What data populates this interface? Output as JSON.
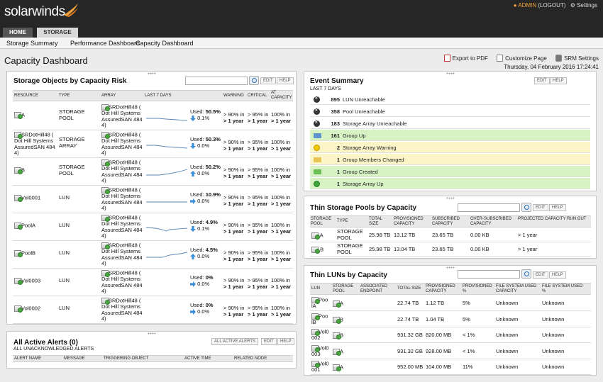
{
  "brand": "solarwinds",
  "user": {
    "name": "ADMIN",
    "logout": "(LOGOUT)",
    "settings": "Settings"
  },
  "tabs": {
    "home": "HOME",
    "storage": "STORAGE"
  },
  "subnav": [
    "Storage Summary",
    "Performance Dashboard",
    "Capacity Dashboard"
  ],
  "page": {
    "title": "Capacity Dashboard",
    "export_pdf": "Export to PDF",
    "customize": "Customize Page",
    "srm_settings": "SRM Settings",
    "datetime": "Thursday, 04 February 2016 17:24:41"
  },
  "buttons": {
    "edit": "EDIT",
    "help": "HELP",
    "all_active_alerts": "ALL ACTIVE ALERTS"
  },
  "risk": {
    "title": "Storage Objects by Capacity Risk",
    "headers": [
      "RESOURCE",
      "TYPE",
      "ARRAY",
      "LAST 7 DAYS",
      "WARNING",
      "CRITICAL",
      "AT CAPACITY"
    ],
    "rows": [
      {
        "resource": "A",
        "type": "STORAGE POOL",
        "array": "SRDotHill48 ( Dot Hill Systems AssuredSAN 484 4)",
        "used_label": "Used:",
        "used": "50.5%",
        "change": "0.1%",
        "dir": "down",
        "warn1": "> 90% in",
        "warn2": "> 1 year",
        "crit1": "> 95% in",
        "crit2": "> 1 year",
        "cap1": "100% in",
        "cap2": "> 1 year"
      },
      {
        "resource": "SRDotHill48 ( Dot Hill Systems AssuredSAN 484 4)",
        "type": "STORAGE ARRAY",
        "array": "SRDotHill48 ( Dot Hill Systems AssuredSAN 484 4)",
        "used_label": "Used:",
        "used": "50.3%",
        "change": "0.0%",
        "dir": "down",
        "warn1": "> 90% in",
        "warn2": "> 1 year",
        "crit1": "> 95% in",
        "crit2": "> 1 year",
        "cap1": "100% in",
        "cap2": "> 1 year"
      },
      {
        "resource": "B",
        "type": "STORAGE POOL",
        "array": "SRDotHill48 ( Dot Hill Systems AssuredSAN 484 4)",
        "used_label": "Used:",
        "used": "50.2%",
        "change": "0.0%",
        "dir": "up",
        "warn1": "> 90% in",
        "warn2": "> 1 year",
        "crit1": "> 95% in",
        "crit2": "> 1 year",
        "cap1": "100% in",
        "cap2": "> 1 year"
      },
      {
        "resource": "Vol0001",
        "type": "LUN",
        "array": "SRDotHill48 ( Dot Hill Systems AssuredSAN 484 4)",
        "used_label": "Used:",
        "used": "10.9%",
        "change": "0.0%",
        "dir": "right",
        "warn1": "> 90% in",
        "warn2": "> 1 year",
        "crit1": "> 95% in",
        "crit2": "> 1 year",
        "cap1": "100% in",
        "cap2": "> 1 year"
      },
      {
        "resource": "PoolA",
        "type": "LUN",
        "array": "SRDotHill48 ( Dot Hill Systems AssuredSAN 484 4)",
        "used_label": "Used:",
        "used": "4.9%",
        "change": "0.1%",
        "dir": "down",
        "warn1": "> 90% in",
        "warn2": "> 1 year",
        "crit1": "> 95% in",
        "crit2": "> 1 year",
        "cap1": "100% in",
        "cap2": "> 1 year"
      },
      {
        "resource": "PoolB",
        "type": "LUN",
        "array": "SRDotHill48 ( Dot Hill Systems AssuredSAN 484 4)",
        "used_label": "Used:",
        "used": "4.5%",
        "change": "0.0%",
        "dir": "up",
        "warn1": "> 90% in",
        "warn2": "> 1 year",
        "crit1": "> 95% in",
        "crit2": "> 1 year",
        "cap1": "100% in",
        "cap2": "> 1 year"
      },
      {
        "resource": "Vol0003",
        "type": "LUN",
        "array": "SRDotHill48 ( Dot Hill Systems AssuredSAN 484 4)",
        "used_label": "Used:",
        "used": "0%",
        "change": "0.0%",
        "dir": "right",
        "warn1": "> 90% in",
        "warn2": "> 1 year",
        "crit1": "> 95% in",
        "crit2": "> 1 year",
        "cap1": "100% in",
        "cap2": "> 1 year"
      },
      {
        "resource": "Vol0002",
        "type": "LUN",
        "array": "SRDotHill48 ( Dot Hill Systems AssuredSAN 484 4)",
        "used_label": "Used:",
        "used": "0%",
        "change": "0.0%",
        "dir": "right",
        "warn1": "> 90% in",
        "warn2": "> 1 year",
        "crit1": "> 95% in",
        "crit2": "> 1 year",
        "cap1": "100% in",
        "cap2": "> 1 year"
      }
    ]
  },
  "alerts": {
    "title": "All Active Alerts (0)",
    "subtitle": "ALL UNACKNOWLEDGED ALERTS",
    "headers": [
      "ALERT NAME",
      "MESSAGE",
      "TRIGGERING OBJECT",
      "ACTIVE TIME",
      "RELATED NODE"
    ]
  },
  "events": {
    "title": "Event Summary",
    "subtitle": "LAST 7 DAYS",
    "rows": [
      {
        "count": "895",
        "label": "LUN Unreachable",
        "icon": "x-circle-icon",
        "tone": "none"
      },
      {
        "count": "358",
        "label": "Pool Unreachable",
        "icon": "x-circle-icon",
        "tone": "none"
      },
      {
        "count": "183",
        "label": "Storage Array Unreachable",
        "icon": "x-circle-icon",
        "tone": "none"
      },
      {
        "count": "161",
        "label": "Group Up",
        "icon": "group-folder-icon",
        "tone": "green"
      },
      {
        "count": "2",
        "label": "Storage Array Warning",
        "icon": "warning-dot-icon",
        "tone": "yellow"
      },
      {
        "count": "1",
        "label": "Group Members Changed",
        "icon": "group-folder-icon",
        "tone": "yellow"
      },
      {
        "count": "1",
        "label": "Group Created",
        "icon": "group-folder-icon",
        "tone": "green"
      },
      {
        "count": "1",
        "label": "Storage Array Up",
        "icon": "up-dot-icon",
        "tone": "green"
      }
    ]
  },
  "thin_pools": {
    "title": "Thin Storage Pools by Capacity",
    "headers": [
      "STORAGE POOL",
      "TYPE",
      "TOTAL SIZE",
      "PROVISIONED CAPACITY",
      "SUBSCRIBED CAPACITY",
      "OVER-SUBSCRIBED CAPACITY",
      "PROJECTED CAPACITY RUN OUT"
    ],
    "rows": [
      {
        "pool": "A",
        "type": "STORAGE POOL",
        "total": "25.98 TB",
        "provisioned": "13.12 TB",
        "subscribed": "23.65 TB",
        "over": "0.00 KB",
        "runout": "> 1 year"
      },
      {
        "pool": "B",
        "type": "STORAGE POOL",
        "total": "25.98 TB",
        "provisioned": "13.04 TB",
        "subscribed": "23.65 TB",
        "over": "0.00 KB",
        "runout": "> 1 year"
      }
    ]
  },
  "thin_luns": {
    "title": "Thin LUNs by Capacity",
    "headers": [
      "LUN",
      "STORAGE POOL",
      "ASSOCIATED ENDPOINT",
      "TOTAL SIZE",
      "PROVISIONED CAPACITY",
      "PROVISIONED %",
      "FILE SYSTEM USED CAPACITY",
      "FILE SYSTEM USED %"
    ],
    "rows": [
      {
        "lun": "Poo lA",
        "pool": "A",
        "total": "22.74 TB",
        "provisioned": "1.12 TB",
        "pct": "5%",
        "fs_cap": "Unknown",
        "fs_pct": "Unknown"
      },
      {
        "lun": "Poo lB",
        "pool": "B",
        "total": "22.74 TB",
        "provisioned": "1.04 TB",
        "pct": "5%",
        "fs_cap": "Unknown",
        "fs_pct": "Unknown"
      },
      {
        "lun": "Vol0 002",
        "pool": "B",
        "total": "931.32 GB",
        "provisioned": "820.00 MB",
        "pct": "< 1%",
        "fs_cap": "Unknown",
        "fs_pct": "Unknown"
      },
      {
        "lun": "Vol0 003",
        "pool": "A",
        "total": "931.32 GB",
        "provisioned": "928.00 MB",
        "pct": "< 1%",
        "fs_cap": "Unknown",
        "fs_pct": "Unknown"
      },
      {
        "lun": "Vol0 001",
        "pool": "A",
        "total": "952.00 MB",
        "provisioned": "104.00 MB",
        "pct": "11%",
        "fs_cap": "Unknown",
        "fs_pct": "Unknown"
      }
    ]
  },
  "colors": {
    "header_bg": "#262626",
    "accent": "#f2a13a",
    "green_row": "#d7f3c4",
    "yellow_row": "#fbf5c7",
    "arrow_blue": "#3d8fd8"
  }
}
